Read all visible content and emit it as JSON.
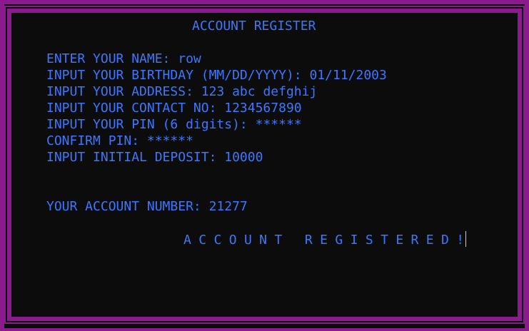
{
  "screen": {
    "title": "ACCOUNT REGISTER",
    "fields": [
      {
        "label": "ENTER YOUR NAME: ",
        "value": "row"
      },
      {
        "label": "INPUT YOUR BIRTHDAY (MM/DD/YYYY): ",
        "value": "01/11/2003"
      },
      {
        "label": "INPUT YOUR ADDRESS: ",
        "value": "123 abc defghij"
      },
      {
        "label": "INPUT YOUR CONTACT NO: ",
        "value": "1234567890"
      },
      {
        "label": "INPUT YOUR PIN (6 digits): ",
        "value": "******"
      },
      {
        "label": "CONFIRM PIN: ",
        "value": "******"
      },
      {
        "label": "INPUT INITIAL DEPOSIT: ",
        "value": "10000"
      }
    ],
    "account_number_label": "YOUR ACCOUNT NUMBER: ",
    "account_number": "21277",
    "status_message": "ACCOUNT REGISTERED!"
  },
  "colors": {
    "background": "#0c0c0c",
    "text": "#3b78ff",
    "frame": "#8b1a8f"
  }
}
